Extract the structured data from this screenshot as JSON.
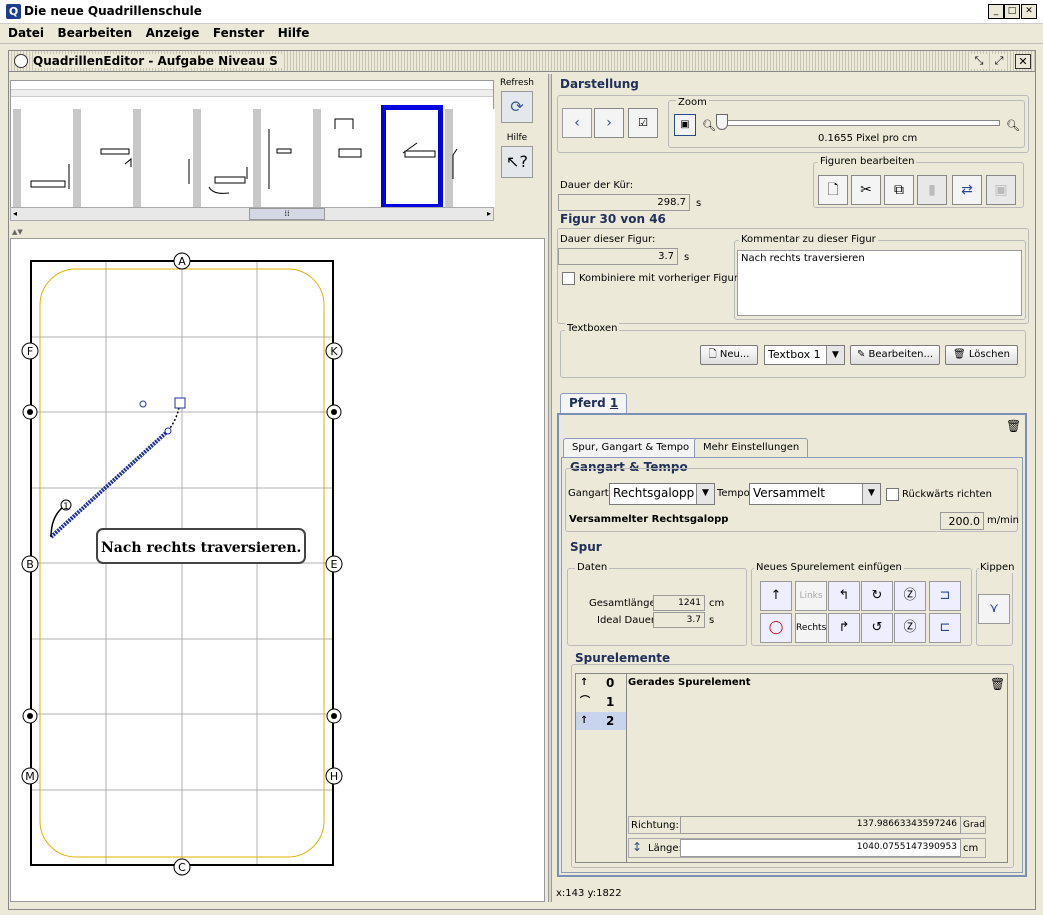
{
  "app": {
    "title": "Die neue Quadrillenschule",
    "icon": "q-app-icon"
  },
  "window_controls": {
    "minimize": "_",
    "maximize": "□",
    "close": "✕"
  },
  "menu": [
    "Datei",
    "Bearbeiten",
    "Anzeige",
    "Fenster",
    "Hilfe"
  ],
  "editor": {
    "title": "QuadrillenEditor - Aufgabe Niveau S"
  },
  "sidetools": {
    "refresh_label": "Refresh",
    "help_label": "Hilfe"
  },
  "arena": {
    "letters": [
      "A",
      "F",
      "K",
      "B",
      "E",
      "M",
      "H",
      "C"
    ],
    "figure_number": "1",
    "textbox": "Nach rechts traversieren."
  },
  "darstellung": {
    "title": "Darstellung",
    "zoom_label": "Zoom",
    "zoom_value_text": "0.1655 Pixel pro cm",
    "zoom_fraction": 0.0
  },
  "kuer": {
    "dauer_label": "Dauer der Kür:",
    "dauer_value": "298.7",
    "unit": "s"
  },
  "figuren": {
    "title": "Figuren bearbeiten"
  },
  "figur": {
    "title": "Figur 30 von 46",
    "dauer_label": "Dauer dieser Figur:",
    "dauer_value": "3.7",
    "unit": "s",
    "kombiniere_label": "Kombiniere mit vorheriger Figur",
    "kommentar_label": "Kommentar zu dieser Figur",
    "kommentar_value": "Nach rechts traversieren"
  },
  "textboxen": {
    "title": "Textboxen",
    "neu": "Neu...",
    "selected": "Textbox 1",
    "bearbeiten": "Bearbeiten...",
    "loeschen": "Löschen"
  },
  "pferd_tab": {
    "label": "Pferd ",
    "underlined": "1"
  },
  "subtabs": [
    "Spur, Gangart & Tempo",
    "Mehr Einstellungen"
  ],
  "gangart": {
    "title": "Gangart & Tempo",
    "gangart_label": "Gangart:",
    "gangart_value": "Rechtsgalopp",
    "tempo_label": "Tempo:",
    "tempo_value": "Versammelt",
    "rueckwaerts_label": "Rückwärts richten",
    "summary": "Versammelter Rechtsgalopp",
    "speed": "200.0",
    "speed_unit": "m/min"
  },
  "spur": {
    "title": "Spur",
    "daten_label": "Daten",
    "gesamt_label": "Gesamtlänge:",
    "gesamt_value": "1241",
    "gesamt_unit": "cm",
    "ideal_label": "Ideal Dauer:",
    "ideal_value": "3.7",
    "ideal_unit": "s",
    "neues_label": "Neues Spurelement einfügen",
    "links_label": "Links",
    "rechts_label": "Rechts",
    "kippen_label": "Kippen"
  },
  "spurelemente": {
    "title": "Spurelemente",
    "items": [
      "0",
      "1",
      "2"
    ],
    "selected_title": "Gerades Spurelement",
    "richtung_label": "Richtung:",
    "richtung_value": "137.98663343597246",
    "richtung_unit": "Grad",
    "laenge_label": "Länge:",
    "laenge_value": "1040.0755147390953",
    "laenge_unit": "cm"
  },
  "status": {
    "coords": "x:143 y:1822"
  },
  "colors": {
    "selection": "#0000e0",
    "track": "#2030a0",
    "arena_line": "#e0b000",
    "grid": "#b0b0b0"
  }
}
